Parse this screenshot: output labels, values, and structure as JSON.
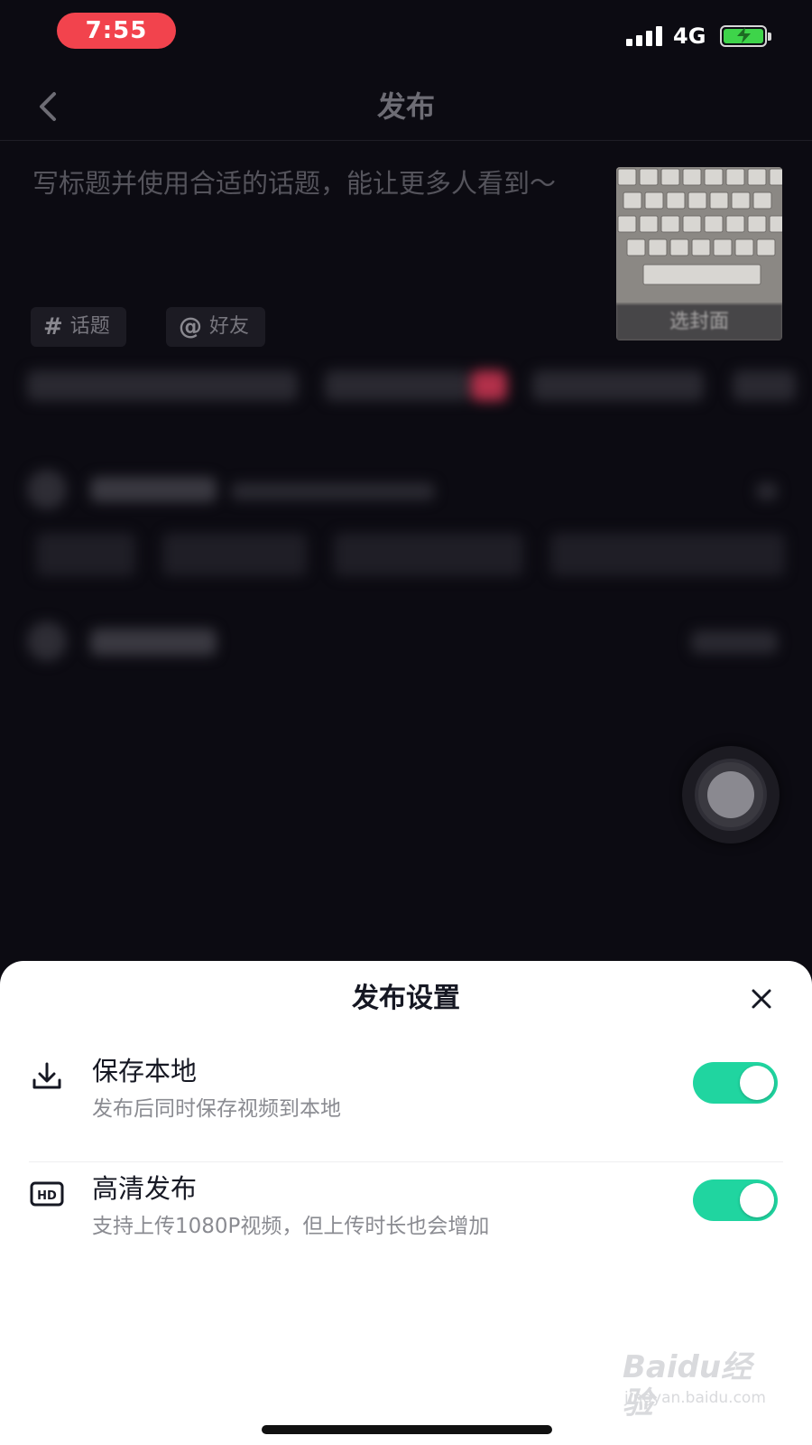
{
  "status_bar": {
    "time": "7:55",
    "network": "4G",
    "icons": [
      "signal-icon",
      "battery-charging-icon"
    ],
    "colors": {
      "time_pill": "#f2434d",
      "battery_fill": "#3ed44a"
    }
  },
  "header": {
    "title": "发布",
    "back_icon": "chevron-left-icon"
  },
  "compose": {
    "title_placeholder": "写标题并使用合适的话题，能让更多人看到～",
    "cover_label": "选封面",
    "chips": [
      {
        "icon": "#",
        "label": "话题"
      },
      {
        "icon": "@",
        "label": "好友"
      }
    ]
  },
  "sheet": {
    "title": "发布设置",
    "close_icon": "close-icon",
    "settings": [
      {
        "icon": "download-icon",
        "title": "保存本地",
        "desc": "发布后同时保存视频到本地",
        "enabled": true
      },
      {
        "icon": "hd-icon",
        "title": "高清发布",
        "desc": "支持上传1080P视频，但上传时长也会增加",
        "enabled": true
      }
    ],
    "colors": {
      "toggle_on": "#20d5a0"
    }
  },
  "watermark": {
    "brand": "Baidu经验",
    "sub": "jingyan.baidu.com"
  }
}
